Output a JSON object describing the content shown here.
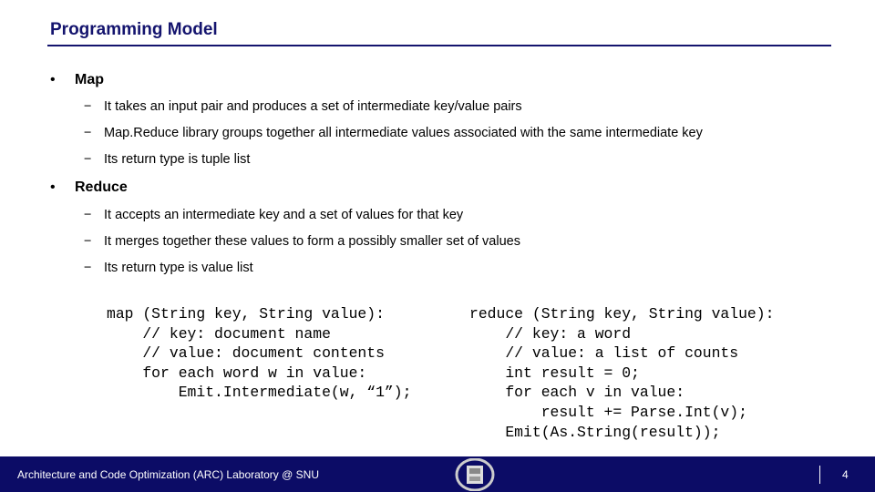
{
  "title": "Programming Model",
  "bullets": [
    {
      "label": "Map",
      "subs": [
        "It takes an input pair and produces a set of intermediate key/value pairs",
        "Map.Reduce library groups together all intermediate values associated with the same intermediate key",
        "Its return type is tuple list"
      ]
    },
    {
      "label": "Reduce",
      "subs": [
        "It accepts an intermediate key and a set of values for that key",
        "It merges together these values to form a possibly smaller set of values",
        "Its return type is value list"
      ]
    }
  ],
  "code": {
    "map": "map (String key, String value):\n    // key: document name\n    // value: document contents\n    for each word w in value:\n        Emit.Intermediate(w, “1”);",
    "reduce": "reduce (String key, String value):\n    // key: a word\n    // value: a list of counts\n    int result = 0;\n    for each v in value:\n        result += Parse.Int(v);\n    Emit(As.String(result));"
  },
  "footer": {
    "lab": "Architecture and Code Optimization (ARC) Laboratory @ SNU",
    "page": "4",
    "logo": "SNU seal"
  },
  "colors": {
    "title": "#14146e",
    "footer_bg": "#0c0c66"
  }
}
